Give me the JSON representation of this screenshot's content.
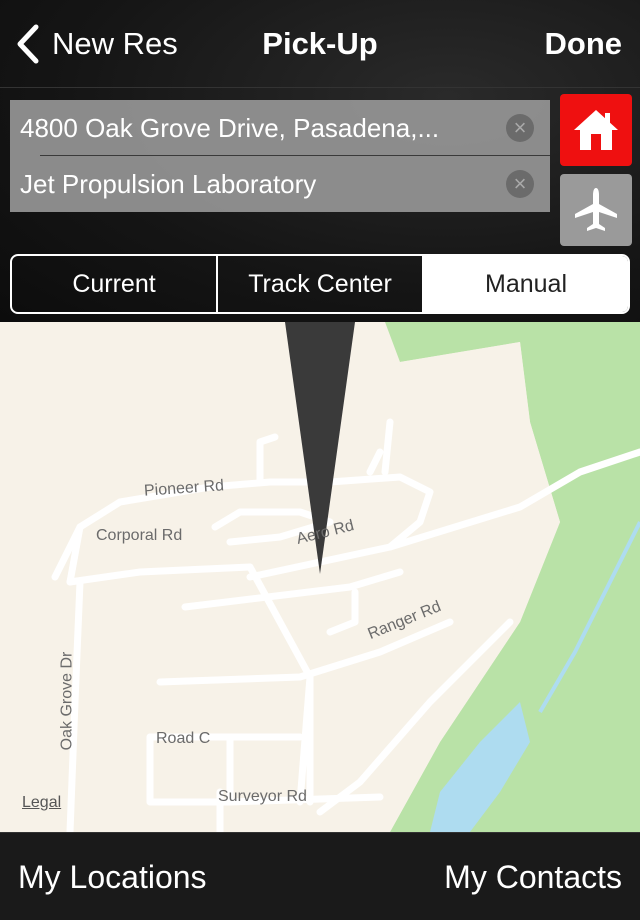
{
  "navbar": {
    "back_label": "New Res",
    "title": "Pick-Up",
    "done_label": "Done"
  },
  "address": {
    "line1": "4800 Oak Grove Drive, Pasadena,...",
    "line2": "Jet Propulsion Laboratory"
  },
  "quick_buttons": {
    "home_icon": "home-icon",
    "airport_icon": "airplane-icon",
    "home_color": "#ef1010",
    "airport_color": "#9a9a9a"
  },
  "segments": [
    {
      "label": "Current",
      "active": false
    },
    {
      "label": "Track Center",
      "active": false
    },
    {
      "label": "Manual",
      "active": true
    }
  ],
  "map": {
    "roads": {
      "pioneer": "Pioneer Rd",
      "corporal": "Corporal Rd",
      "aero": "Aero Rd",
      "ranger": "Ranger Rd",
      "oak_grove": "Oak Grove Dr",
      "road_c": "Road C",
      "surveyor": "Surveyor Rd"
    },
    "legal_label": "Legal",
    "colors": {
      "land": "#f7f2e8",
      "park": "#b9e2a7",
      "water": "#aedcf0",
      "road": "#ffffff"
    }
  },
  "bottom_bar": {
    "left_label": "My Locations",
    "right_label": "My Contacts"
  }
}
